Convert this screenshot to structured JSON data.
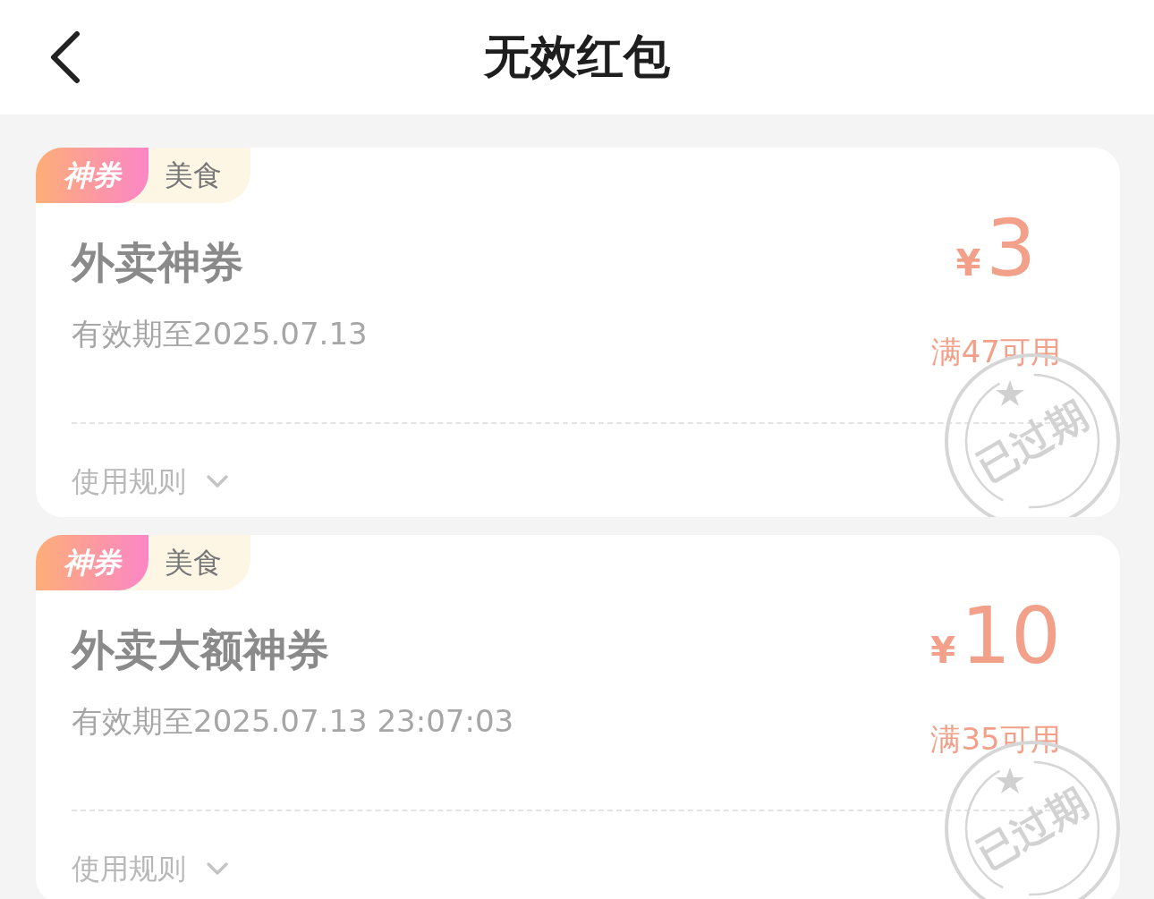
{
  "header": {
    "title": "无效红包"
  },
  "coupons": [
    {
      "badge": "神券",
      "category": "美食",
      "name": "外卖神券",
      "validity": "有效期至2025.07.13",
      "currency": "¥",
      "amount": "3",
      "condition": "满47可用",
      "rules_label": "使用规则",
      "stamp": "已过期"
    },
    {
      "badge": "神券",
      "category": "美食",
      "name": "外卖大额神券",
      "validity": "有效期至2025.07.13 23:07:03",
      "currency": "¥",
      "amount": "10",
      "condition": "满35可用",
      "rules_label": "使用规则",
      "stamp": "已过期"
    }
  ]
}
